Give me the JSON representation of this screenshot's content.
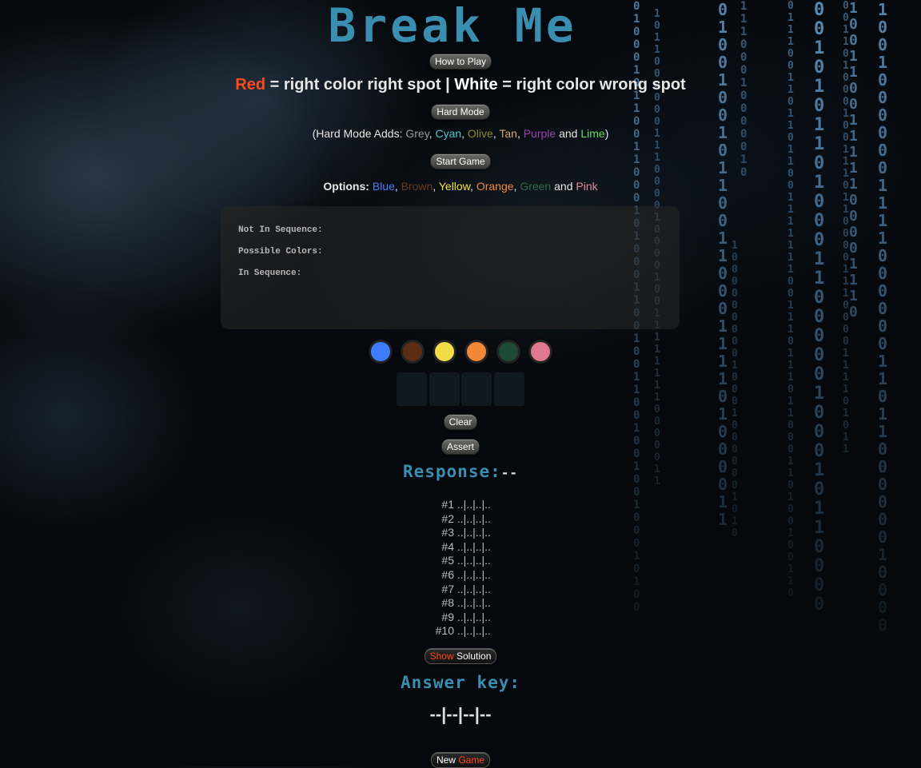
{
  "title": "Break Me",
  "buttons": {
    "how_to_play": "How to Play",
    "hard_mode": "Hard Mode",
    "start_game": "Start Game",
    "clear": "Clear",
    "assert": "Assert",
    "show_solution_red": "Show",
    "show_solution_white": "Solution",
    "new_game_white": "New",
    "new_game_red": "Game"
  },
  "rules": {
    "red_word": "Red",
    "red_text": "= right color right spot |",
    "white_word": "White",
    "white_text": "= right color wrong spot"
  },
  "hard_mode_note": {
    "prefix": "(Hard Mode Adds:",
    "colors": [
      {
        "name": "Grey",
        "color": "#9a9a9a"
      },
      {
        "name": "Cyan",
        "color": "#3fc8d0"
      },
      {
        "name": "Olive",
        "color": "#8c8a2a"
      },
      {
        "name": "Tan",
        "color": "#d2a66a"
      },
      {
        "name": "Purple",
        "color": "#9b3fb0"
      },
      {
        "name": "Lime",
        "color": "#5ee05e"
      }
    ],
    "and": "and",
    "suffix": ")"
  },
  "options": {
    "label": "Options:",
    "colors": [
      {
        "name": "Blue",
        "color": "#4d7fff"
      },
      {
        "name": "Brown",
        "color": "#6b3a1e"
      },
      {
        "name": "Yellow",
        "color": "#f2e24a"
      },
      {
        "name": "Orange",
        "color": "#f28a3a"
      },
      {
        "name": "Green",
        "color": "#2e6b4a"
      },
      {
        "name": "Pink",
        "color": "#e58aa0"
      }
    ],
    "and": "and"
  },
  "panel": {
    "not_in_sequence": "Not In Sequence:",
    "possible_colors": "Possible Colors:",
    "in_sequence": "In Sequence:"
  },
  "swatches": [
    {
      "name": "blue",
      "color": "#3f7bff"
    },
    {
      "name": "brown",
      "color": "#5a2e14"
    },
    {
      "name": "yellow",
      "color": "#f0dc48"
    },
    {
      "name": "orange",
      "color": "#f08838"
    },
    {
      "name": "green",
      "color": "#1f4a33"
    },
    {
      "name": "pink",
      "color": "#e07890"
    }
  ],
  "response": {
    "label": "Response:",
    "value": "--"
  },
  "guesses": [
    {
      "num": "#1",
      "text": "..|..|..|.."
    },
    {
      "num": "#2",
      "text": "..|..|..|.."
    },
    {
      "num": "#3",
      "text": "..|..|..|.."
    },
    {
      "num": "#4",
      "text": "..|..|..|.."
    },
    {
      "num": "#5",
      "text": "..|..|..|.."
    },
    {
      "num": "#6",
      "text": "..|..|..|.."
    },
    {
      "num": "#7",
      "text": "..|..|..|.."
    },
    {
      "num": "#8",
      "text": "..|..|..|.."
    },
    {
      "num": "#9",
      "text": "..|..|..|.."
    },
    {
      "num": "#10",
      "text": "..|..|..|.."
    }
  ],
  "answer": {
    "label": "Answer key:",
    "value": "--|--|--|--"
  },
  "colors": {
    "accent": "#3a8fb0",
    "red": "#ff4a1a"
  }
}
